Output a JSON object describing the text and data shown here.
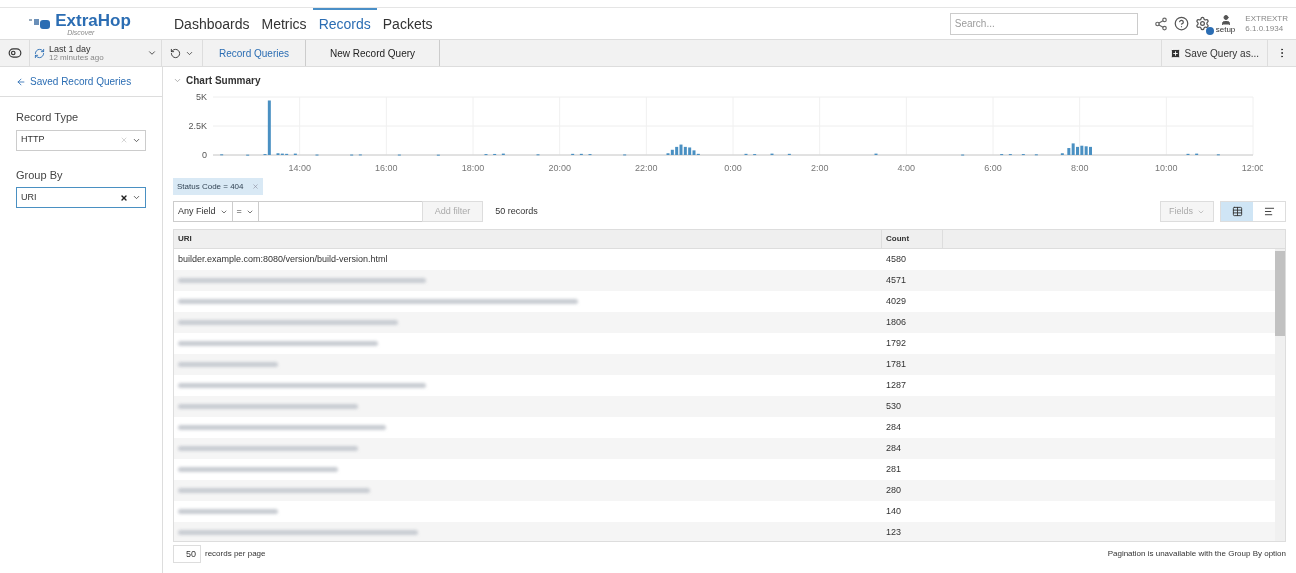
{
  "header": {
    "logo": {
      "name": "ExtraHop",
      "subtitle": "Discover"
    },
    "nav": [
      {
        "label": "Dashboards",
        "selected": false
      },
      {
        "label": "Metrics",
        "selected": false
      },
      {
        "label": "Records",
        "selected": true
      },
      {
        "label": "Packets",
        "selected": false
      }
    ],
    "search": {
      "placeholder": "Search..."
    },
    "setup_label": "setup",
    "version": [
      "EXTREXTR",
      "6.1.0.1934"
    ]
  },
  "toolbar": {
    "time_range": {
      "label": "Last 1 day",
      "sub": "12 minutes ago"
    },
    "breadcrumbs": [
      {
        "label": "Record Queries",
        "kind": "link"
      },
      {
        "label": "New Record Query",
        "kind": "current"
      }
    ],
    "save_button": "Save Query as..."
  },
  "sidebar": {
    "back_link": "Saved Record Queries",
    "fields": [
      {
        "label": "Record Type",
        "value": "HTTP",
        "focused": false
      },
      {
        "label": "Group By",
        "value": "URI",
        "focused": true
      }
    ]
  },
  "chart_section": {
    "title": "Chart Summary",
    "expanded": true,
    "histogram": {
      "y_labels": [
        "5K",
        "2.5K",
        "0"
      ],
      "x_labels": [
        "14:00",
        "16:00",
        "18:00",
        "20:00",
        "22:00",
        "0:00",
        "2:00",
        "4:00",
        "6:00",
        "8:00",
        "10:00",
        "12:00"
      ]
    }
  },
  "filters": [
    {
      "label": "Status Code = 404"
    }
  ],
  "query": {
    "field": "Any Field",
    "operator": "=",
    "add_button": "Add filter",
    "count": "50 records",
    "fields_button": "Fields",
    "views": [
      {
        "kind": "table",
        "selected": true
      },
      {
        "kind": "list",
        "selected": false
      }
    ]
  },
  "table": {
    "columns": [
      "URI",
      "Count"
    ],
    "rows": [
      {
        "uri": "builder.example.com:8080/version/build-version.html",
        "blurred": false,
        "count": "4580"
      },
      {
        "blurred": true,
        "count": "4571"
      },
      {
        "blurred": true,
        "count": "4029"
      },
      {
        "blurred": true,
        "count": "1806"
      },
      {
        "blurred": true,
        "count": "1792"
      },
      {
        "blurred": true,
        "count": "1781"
      },
      {
        "blurred": true,
        "count": "1287"
      },
      {
        "blurred": true,
        "count": "530"
      },
      {
        "blurred": true,
        "count": "284"
      },
      {
        "blurred": true,
        "count": "284"
      },
      {
        "blurred": true,
        "count": "281"
      },
      {
        "blurred": true,
        "count": "280"
      },
      {
        "blurred": true,
        "count": "140"
      },
      {
        "blurred": true,
        "count": "123"
      }
    ]
  },
  "footer": {
    "per_page": "50",
    "per_page_label": "records per page",
    "note": "Pagination is unavailable with the Group By option"
  }
}
